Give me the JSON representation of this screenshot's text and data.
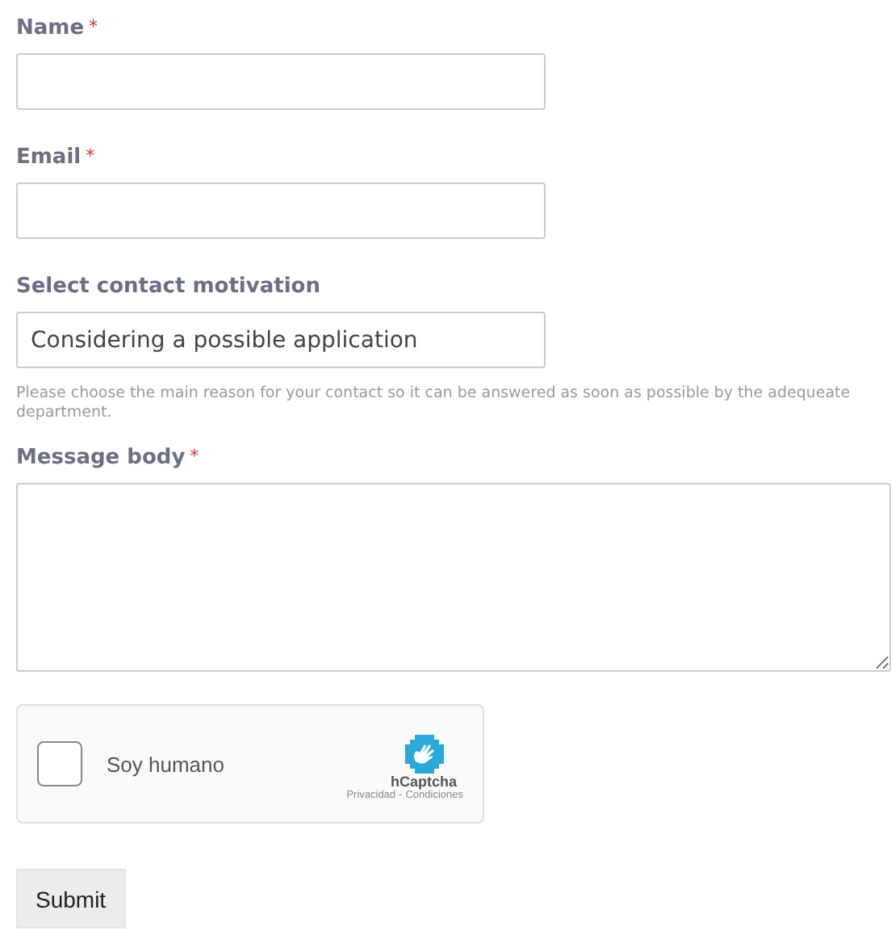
{
  "fields": [
    {
      "kind": "text",
      "label": "Name",
      "required_mark": "*"
    },
    {
      "kind": "text",
      "label": "Email",
      "required_mark": "*"
    },
    {
      "kind": "select",
      "label": "Select contact motivation",
      "value": "Considering a possible application",
      "help": "Please choose the main reason for your contact so it can be answered as soon as possible by the adequeate department."
    },
    {
      "kind": "textarea",
      "label": "Message body",
      "required_mark": "*"
    }
  ],
  "captcha": {
    "checked": false,
    "label": "Soy humano",
    "brand": "hCaptcha",
    "privacy": "Privacidad",
    "separator": "-",
    "terms": "Condiciones"
  },
  "submit": "Submit"
}
